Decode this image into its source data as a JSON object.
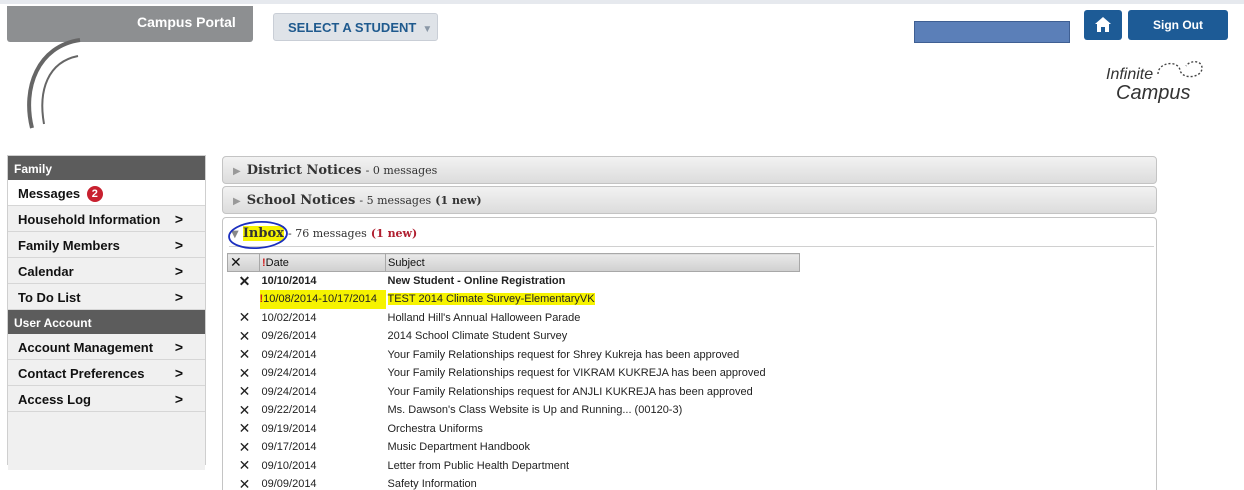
{
  "header": {
    "app_title": "Campus Portal",
    "select_student_label": "SELECT A STUDENT",
    "sign_out_label": "Sign Out",
    "logo_line1": "Infinite",
    "logo_line2": "Campus"
  },
  "sidebar": {
    "family_header": "Family",
    "messages_label": "Messages",
    "messages_badge": "2",
    "family_items": [
      {
        "label": "Household Information",
        "arrow": ">"
      },
      {
        "label": "Family Members",
        "arrow": ">"
      },
      {
        "label": "Calendar",
        "arrow": ">"
      },
      {
        "label": "To Do List",
        "arrow": ">"
      }
    ],
    "account_header": "User Account",
    "account_items": [
      {
        "label": "Account Management",
        "arrow": ">"
      },
      {
        "label": "Contact Preferences",
        "arrow": ">"
      },
      {
        "label": "Access Log",
        "arrow": ">"
      }
    ]
  },
  "panels": {
    "district": {
      "name": "District Notices",
      "count": "- 0 messages"
    },
    "school": {
      "name": "School Notices",
      "count": "- 5 messages",
      "new": "(1 new)"
    },
    "inbox": {
      "name": "Inbox",
      "count": "- 76 messages",
      "new": "(1 new)"
    }
  },
  "messages": {
    "col_delete": "✕",
    "col_flag": "!",
    "col_date": "Date",
    "col_subject": "Subject",
    "rows": [
      {
        "x": "✕",
        "flag": "",
        "date": "10/10/2014",
        "subject": "New Student - Online Registration"
      },
      {
        "x": "",
        "flag": "!",
        "date": "10/08/2014-10/17/2014",
        "subject": "TEST 2014 Climate Survey-ElementaryVK"
      },
      {
        "x": "✕",
        "flag": "",
        "date": "10/02/2014",
        "subject": "Holland Hill's Annual Halloween Parade"
      },
      {
        "x": "✕",
        "flag": "",
        "date": "09/26/2014",
        "subject": "2014 School Climate Student Survey"
      },
      {
        "x": "✕",
        "flag": "",
        "date": "09/24/2014",
        "subject": "Your Family Relationships request for Shrey Kukreja has been approved"
      },
      {
        "x": "✕",
        "flag": "",
        "date": "09/24/2014",
        "subject": "Your Family Relationships request for VIKRAM KUKREJA has been approved"
      },
      {
        "x": "✕",
        "flag": "",
        "date": "09/24/2014",
        "subject": "Your Family Relationships request for ANJLI KUKREJA has been approved"
      },
      {
        "x": "✕",
        "flag": "",
        "date": "09/22/2014",
        "subject": "Ms. Dawson's Class Website is Up and Running... (00120-3)"
      },
      {
        "x": "✕",
        "flag": "",
        "date": "09/19/2014",
        "subject": "Orchestra Uniforms"
      },
      {
        "x": "✕",
        "flag": "",
        "date": "09/17/2014",
        "subject": "Music Department Handbook"
      },
      {
        "x": "✕",
        "flag": "",
        "date": "09/10/2014",
        "subject": "Letter from Public Health Department"
      },
      {
        "x": "✕",
        "flag": "",
        "date": "09/09/2014",
        "subject": "Safety Information"
      }
    ]
  },
  "colors": {
    "brand_blue": "#1d5b96",
    "highlight": "#f6f300",
    "new_red": "#b01e2f"
  }
}
